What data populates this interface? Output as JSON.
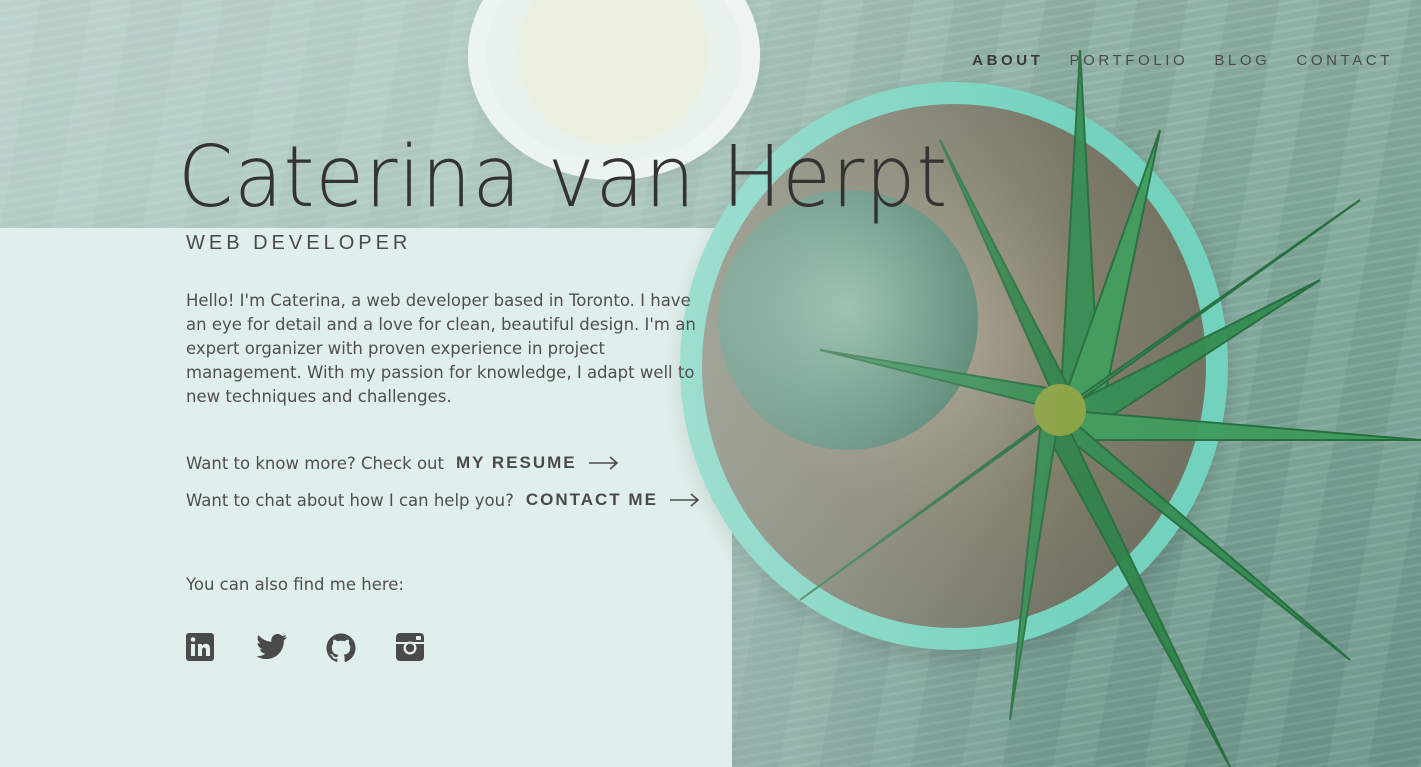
{
  "nav": {
    "items": [
      {
        "label": "ABOUT",
        "active": true
      },
      {
        "label": "PORTFOLIO",
        "active": false
      },
      {
        "label": "BLOG",
        "active": false
      },
      {
        "label": "CONTACT",
        "active": false
      }
    ]
  },
  "hero": {
    "name": "Caterina van Herpt",
    "role": "WEB DEVELOPER",
    "bio": "Hello! I'm Caterina, a web developer based in Toronto. I have an eye for detail and a love for clean, beautiful design. I'm an expert organizer with proven experience in project management. With my passion for knowledge, I adapt well to new techniques and challenges."
  },
  "cta": {
    "resume_prompt": "Want to know more? Check out",
    "resume_link": "MY RESUME",
    "contact_prompt": "Want to chat about how I can help you?",
    "contact_link": "CONTACT ME"
  },
  "social": {
    "heading": "You can also find me here:",
    "icons": [
      "linkedin-icon",
      "twitter-icon",
      "github-icon",
      "instagram-icon"
    ]
  },
  "colors": {
    "text": "#4a4a4a",
    "wash": "#e1f0ec",
    "pot": "#6fd1bc"
  }
}
